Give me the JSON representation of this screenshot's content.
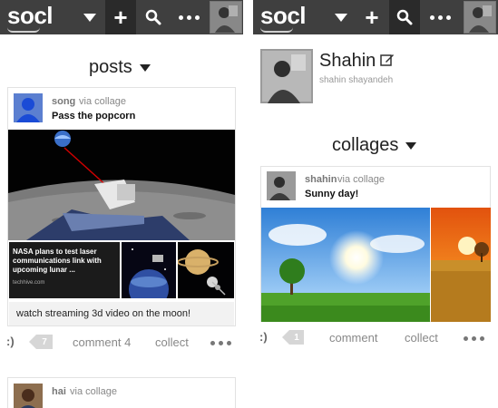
{
  "topbar": {
    "logo": "socl",
    "icons": [
      "chevron-down-icon",
      "plus-icon",
      "search-icon",
      "more-icon",
      "avatar"
    ]
  },
  "left": {
    "section_title": "posts",
    "post1": {
      "author": "song",
      "via": "via collage",
      "title": "Pass the popcorn",
      "news_text": "NASA plans to test laser communications link with upcoming lunar ...",
      "news_source": "techhive.com",
      "caption": "watch streaming 3d video on the moon!",
      "actions": {
        "smile": ":)",
        "count": "7",
        "comment": "comment 4",
        "collect": "collect"
      }
    },
    "post2": {
      "author": "hai",
      "via": "via collage"
    }
  },
  "right": {
    "profile": {
      "name": "Shahin",
      "handle": "shahin shayandeh"
    },
    "section_title": "collages",
    "post": {
      "author": "shahin",
      "via": "via collage",
      "title": "Sunny day!",
      "actions": {
        "smile": ":)",
        "count": "1",
        "comment": "comment",
        "collect": "collect"
      }
    }
  },
  "colors": {
    "topbar": "#3f3f3f",
    "topbar_active": "#2a2a2a",
    "accent_text": "#888888"
  }
}
